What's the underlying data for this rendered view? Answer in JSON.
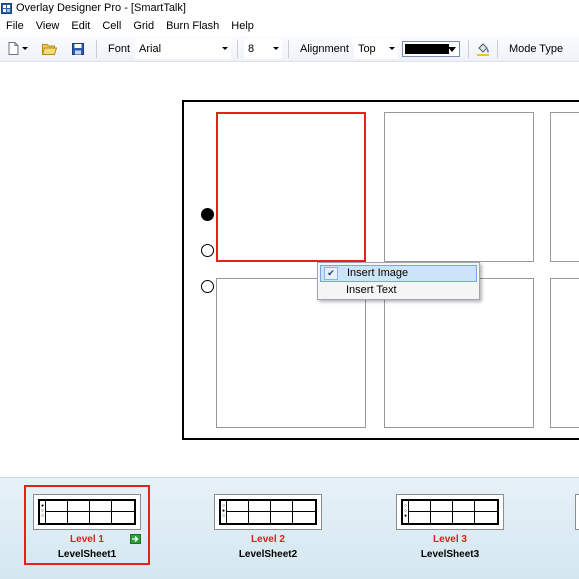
{
  "window": {
    "title": "Overlay Designer Pro - [SmartTalk]"
  },
  "menu": {
    "items": [
      "File",
      "View",
      "Edit",
      "Cell",
      "Grid",
      "Burn Flash",
      "Help"
    ]
  },
  "toolbar": {
    "font_label": "Font",
    "font_value": "Arial",
    "size_value": "8",
    "alignment_label": "Alignment",
    "alignment_value": "Top",
    "color_value": "#000000",
    "mode_type_label": "Mode Type"
  },
  "context_menu": {
    "items": [
      {
        "label": "Insert Image",
        "checked": true,
        "highlighted": true
      },
      {
        "label": "Insert Text",
        "checked": false,
        "highlighted": false
      }
    ]
  },
  "levels": [
    {
      "level_label": "Level 1",
      "sheet_label": "LevelSheet1",
      "selected": true,
      "has_go_icon": true
    },
    {
      "level_label": "Level 2",
      "sheet_label": "LevelSheet2",
      "selected": false,
      "has_go_icon": false
    },
    {
      "level_label": "Level 3",
      "sheet_label": "LevelSheet3",
      "selected": false,
      "has_go_icon": false
    }
  ],
  "colors": {
    "selection_red": "#e8201c",
    "level_text_red": "#e01e1a",
    "menu_highlight": "#cde3f8",
    "go_green": "#2e9e3a"
  }
}
